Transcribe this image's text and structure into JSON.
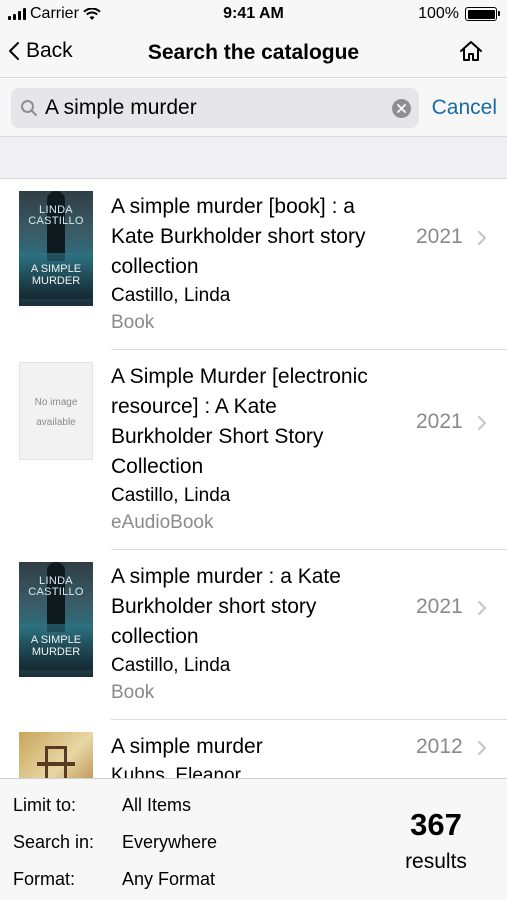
{
  "status_bar": {
    "carrier": "Carrier",
    "time": "9:41 AM",
    "battery": "100%"
  },
  "nav": {
    "back_label": "Back",
    "title": "Search the catalogue"
  },
  "search": {
    "value": "A simple murder",
    "cancel_label": "Cancel"
  },
  "results": [
    {
      "title_lines": [
        "A simple murder [book] : a",
        "Kate Burkholder short story",
        "collection"
      ],
      "author": "Castillo, Linda",
      "format": "Book",
      "year": "2021",
      "cover": "book-cover",
      "cover_text": {
        "author": "LINDA CASTILLO",
        "title": "A SIMPLE MURDER"
      }
    },
    {
      "title_lines": [
        "A Simple Murder [electronic",
        "resource] : A Kate",
        "Burkholder Short Story",
        "Collection"
      ],
      "author": "Castillo, Linda",
      "format": "eAudioBook",
      "year": "2021",
      "cover": "no-image",
      "cover_text": {
        "line1": "No image",
        "line2": "available"
      }
    },
    {
      "title_lines": [
        "A simple murder : a Kate",
        "Burkholder short story",
        "collection"
      ],
      "author": "Castillo, Linda",
      "format": "Book",
      "year": "2021",
      "cover": "book-cover",
      "cover_text": {
        "author": "LINDA CASTILLO",
        "title": "A SIMPLE MURDER"
      }
    },
    {
      "title_lines": [
        "A simple murder"
      ],
      "author": "Kuhns, Eleanor",
      "format": "",
      "year": "2012",
      "cover": "photo-cover"
    }
  ],
  "footer": {
    "limit_label": "Limit to:",
    "limit_value": "All Items",
    "search_in_label": "Search in:",
    "search_in_value": "Everywhere",
    "format_label": "Format:",
    "format_value": "Any Format",
    "count": "367",
    "count_label": "results"
  },
  "colors": {
    "accent": "#1a6aa8",
    "secondary_text": "#8a8a8a",
    "bar_bg": "#f7f7f7"
  }
}
